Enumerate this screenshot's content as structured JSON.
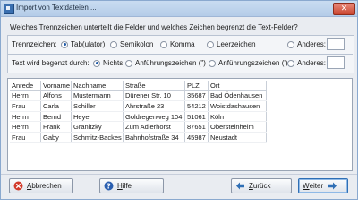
{
  "window": {
    "title": "Import von Textdateien ...",
    "close_label": "✕"
  },
  "question": "Welches Trennzeichen unterteilt die Felder und welches Zeichen begrenzt die Text-Felder?",
  "separator": {
    "label": "Trennzeichen:",
    "options": [
      {
        "label": "Tab(ulator)",
        "selected": true
      },
      {
        "label": "Semikolon",
        "selected": false
      },
      {
        "label": "Komma",
        "selected": false
      },
      {
        "label": "Leerzeichen",
        "selected": false
      },
      {
        "label": "Anderes:",
        "selected": false
      }
    ],
    "other_value": ""
  },
  "text_qualifier": {
    "label": "Text wird begenzt durch:",
    "options": [
      {
        "label": "Nichts",
        "selected": true
      },
      {
        "label": "Anführungszeichen (\")",
        "selected": false
      },
      {
        "label": "Anführungszeichen (')",
        "selected": false
      },
      {
        "label": "Anderes:",
        "selected": false
      }
    ],
    "other_value": ""
  },
  "preview": {
    "columns": [
      "Anrede",
      "Vorname",
      "Nachname",
      "Straße",
      "PLZ",
      "Ort"
    ],
    "rows": [
      [
        "Herrn",
        "Alfons",
        "Mustermann",
        "Dürener Str. 10",
        "35687",
        "Bad Ödenhausen"
      ],
      [
        "Frau",
        "Carla",
        "Schiller",
        "Ahrstraße 23",
        "54212",
        "Woistdashausen"
      ],
      [
        "Herrn",
        "Bernd",
        "Heyer",
        "Goldregenweg 104",
        "51061",
        "Köln"
      ],
      [
        "Herrn",
        "Frank",
        "Granitzky",
        "Zum Adlerhorst",
        "87651",
        "Obersteinheim"
      ],
      [
        "Frau",
        "Gaby",
        "Schmitz-Backes",
        "Bahnhofstraße 34",
        "45987",
        "Neustadt"
      ]
    ]
  },
  "buttons": {
    "cancel_first": "A",
    "cancel_rest": "bbrechen",
    "help_first": "H",
    "help_rest": "ilfe",
    "back_first": "Z",
    "back_rest": "urück",
    "next_first": "W",
    "next_rest": "eiter"
  },
  "colors": {
    "accent": "#2f6fb5",
    "cancel_icon": "#d23a2a",
    "help_icon": "#2a5fb0",
    "arrow": "#2f6fb5"
  }
}
